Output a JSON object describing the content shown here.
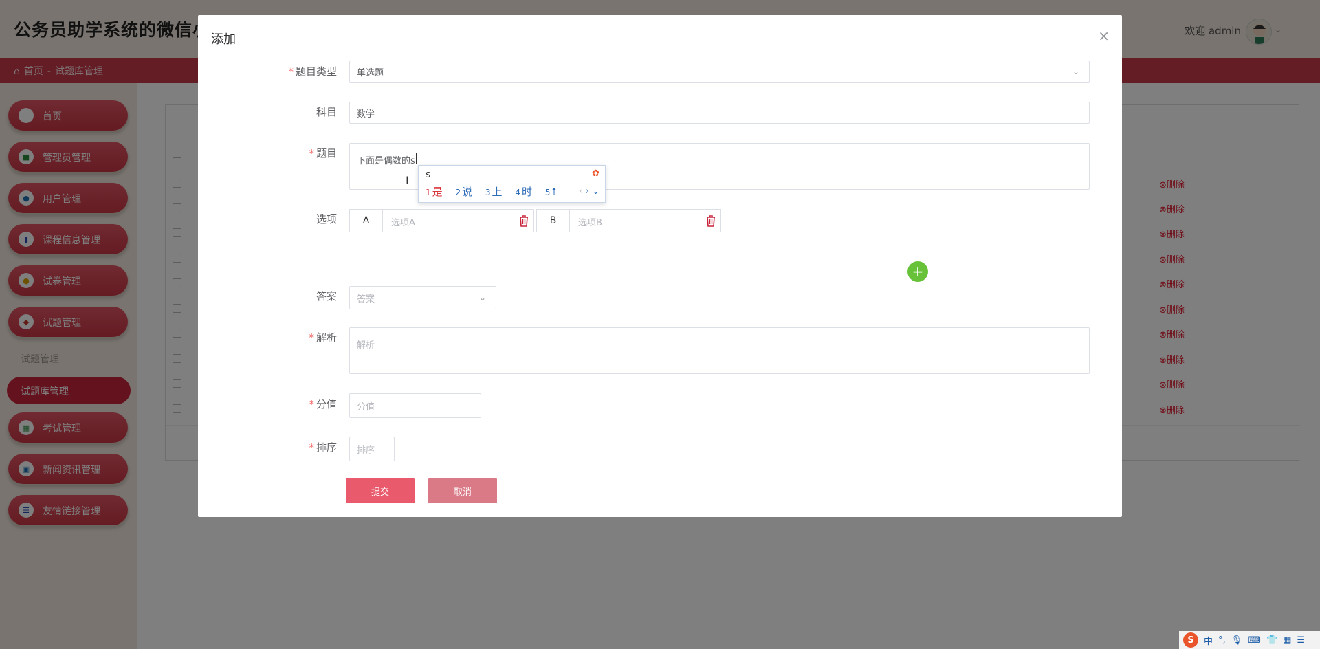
{
  "header": {
    "app_title": "公务员助学系统的微信小",
    "welcome": "欢迎 admin"
  },
  "breadcrumb": {
    "home": "首页",
    "separator": "-",
    "current": "试题库管理"
  },
  "sidebar": {
    "items": [
      {
        "label": "首页",
        "icon": "home-icon"
      },
      {
        "label": "管理员管理",
        "icon": "admin-icon"
      },
      {
        "label": "用户管理",
        "icon": "user-icon"
      },
      {
        "label": "课程信息管理",
        "icon": "course-icon"
      },
      {
        "label": "试卷管理",
        "icon": "paper-icon"
      },
      {
        "label": "试题管理",
        "icon": "question-icon"
      }
    ],
    "sub_header": "试题管理",
    "active_item": "试题库管理",
    "items_after": [
      {
        "label": "考试管理",
        "icon": "exam-icon"
      },
      {
        "label": "新闻资讯管理",
        "icon": "news-icon"
      },
      {
        "label": "友情链接管理",
        "icon": "link-icon"
      }
    ]
  },
  "table": {
    "delete_label": "删除"
  },
  "dialog": {
    "title": "添加",
    "fields": {
      "type": {
        "label": "题目类型",
        "value": "单选题"
      },
      "subject": {
        "label": "科目",
        "value": "数学"
      },
      "question": {
        "label": "题目",
        "value": "下面是偶数的s"
      },
      "options": {
        "label": "选项",
        "a_letter": "A",
        "a_placeholder": "选项A",
        "b_letter": "B",
        "b_placeholder": "选项B"
      },
      "answer": {
        "label": "答案",
        "placeholder": "答案"
      },
      "analysis": {
        "label": "解析",
        "placeholder": "解析"
      },
      "score": {
        "label": "分值",
        "placeholder": "分值"
      },
      "order": {
        "label": "排序",
        "placeholder": "排序"
      }
    },
    "submit_label": "提交",
    "cancel_label": "取消"
  },
  "ime": {
    "code": "s",
    "candidates": [
      {
        "num": "1",
        "text": "是"
      },
      {
        "num": "2",
        "text": "说"
      },
      {
        "num": "3",
        "text": "上"
      },
      {
        "num": "4",
        "text": "时"
      },
      {
        "num": "5",
        "text": "⭡"
      }
    ]
  },
  "tray": {
    "lang": "中",
    "logo": "S"
  },
  "colors": {
    "primary": "#c8384a",
    "submit": "#e85a6c",
    "cancel": "#d97a86",
    "add": "#67c23a",
    "required": "#f56c6c"
  }
}
